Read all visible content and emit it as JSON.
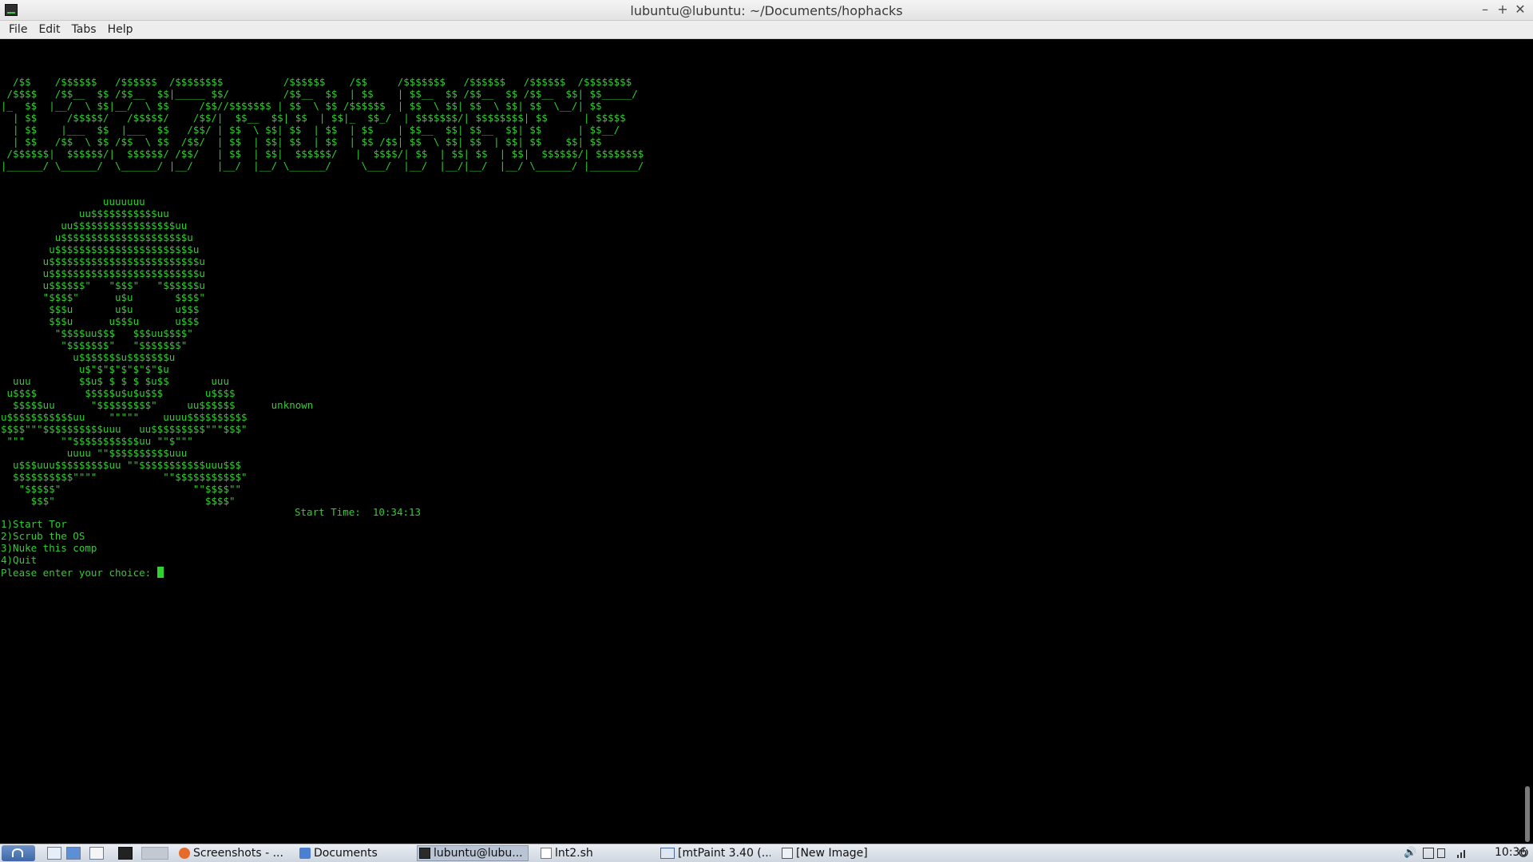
{
  "window": {
    "title": "lubuntu@lubuntu: ~/Documents/hophacks",
    "buttons": {
      "minimize": "–",
      "maximize": "+",
      "close": "✕"
    }
  },
  "menubar": {
    "items": [
      "File",
      "Edit",
      "Tabs",
      "Help"
    ]
  },
  "terminal": {
    "banner": "  /$$    /$$$$$$   /$$$$$$  /$$$$$$$$          /$$$$$$    /$$     /$$$$$$$   /$$$$$$   /$$$$$$  /$$$$$$$$\n /$$$$   /$$__  $$ /$$__  $$|_____ $$/         /$$__  $$  | $$    | $$__  $$ /$$__  $$ /$$__  $$| $$_____/\n|_  $$  |__/  \\ $$|__/  \\ $$     /$$//$$$$$$$ | $$  \\ $$ /$$$$$$  | $$  \\ $$| $$  \\ $$| $$  \\__/| $$\n  | $$     /$$$$$/   /$$$$$/    /$$/|  $$__  $$| $$  | $$|_  $$_/  | $$$$$$$/| $$$$$$$$| $$      | $$$$$\n  | $$    |___  $$  |___  $$   /$$/ | $$  \\ $$| $$  | $$  | $$    | $$__  $$| $$__  $$| $$      | $$__/\n  | $$   /$$  \\ $$ /$$  \\ $$  /$$/  | $$  | $$| $$  | $$  | $$ /$$| $$  \\ $$| $$  | $$| $$    $$| $$\n /$$$$$$|  $$$$$$/|  $$$$$$/ /$$/   | $$  | $$|  $$$$$$/   |  $$$$/| $$  | $$| $$  | $$|  $$$$$$/| $$$$$$$$\n|______/ \\______/  \\______/ |__/    |__/  |__/ \\______/     \\___/  |__/  |__/|__/  |__/ \\______/ |________/",
    "skull": "                 uuuuuuu\n             uu$$$$$$$$$$$uu\n          uu$$$$$$$$$$$$$$$$$uu\n         u$$$$$$$$$$$$$$$$$$$$$u\n        u$$$$$$$$$$$$$$$$$$$$$$$u\n       u$$$$$$$$$$$$$$$$$$$$$$$$$u\n       u$$$$$$$$$$$$$$$$$$$$$$$$$u\n       u$$$$$$\"   \"$$$\"   \"$$$$$$u\n       \"$$$$\"      u$u       $$$$\"\n        $$$u       u$u       u$$$\n        $$$u      u$$$u      u$$$\n         \"$$$$uu$$$   $$$uu$$$$\"\n          \"$$$$$$$\"   \"$$$$$$$\"\n            u$$$$$$$u$$$$$$$u\n             u$\"$\"$\"$\"$\"$\"$u\n  uuu        $$u$ $ $ $ $u$$       uuu\n u$$$$        $$$$$u$u$u$$$       u$$$$\n  $$$$$uu      \"$$$$$$$$$\"     uu$$$$$$      unknown\nu$$$$$$$$$$$uu    \"\"\"\"\"    uuuu$$$$$$$$$$\n$$$$\"\"\"$$$$$$$$$$uuu   uu$$$$$$$$$\"\"\"$$$\"\n \"\"\"      \"\"$$$$$$$$$$$uu \"\"$\"\"\"\n           uuuu \"\"$$$$$$$$$$uuu\n  u$$$uuu$$$$$$$$$uu \"\"$$$$$$$$$$$uuu$$$\n  $$$$$$$$$$\"\"\"\"           \"\"$$$$$$$$$$$\"\n   \"$$$$$\"                      \"\"$$$$\"\"\n     $$$\"                         $$$$\"",
    "start_time_label": "Start Time:",
    "start_time": "10:34:13",
    "options": [
      "1)Start Tor",
      "2)Scrub the OS",
      "3)Nuke this comp",
      "4)Quit"
    ],
    "prompt": "Please enter your choice: "
  },
  "taskbar": {
    "tasks": [
      {
        "label": "Screenshots - ...",
        "icon": "firefox-icon"
      },
      {
        "label": "Documents",
        "icon": "folder-icon"
      },
      {
        "label": "lubuntu@lubu...",
        "icon": "terminal-icon",
        "active": true
      },
      {
        "label": "lnt2.sh",
        "icon": "text-file-icon"
      },
      {
        "label": "[mtPaint 3.40 (...",
        "icon": "mtpaint-icon"
      },
      {
        "label": "[New Image]",
        "icon": "image-window-icon"
      }
    ],
    "clock": "10:36"
  },
  "colors": {
    "terminal_bg": "#000000",
    "terminal_fg": "#32cd32",
    "taskbar_active": "#b9c4d4"
  }
}
